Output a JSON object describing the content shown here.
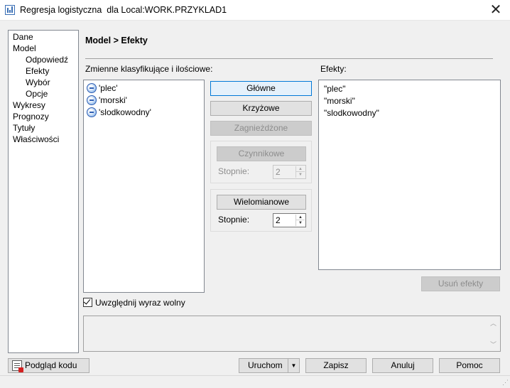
{
  "window": {
    "title": "Regresja logistyczna  dla Local:WORK.PRZYKLAD1",
    "app_icon": "chart-bars-icon",
    "close_icon": "close-icon",
    "close_glyph": "✕"
  },
  "nav": {
    "items": [
      {
        "label": "Dane"
      },
      {
        "label": "Model"
      },
      {
        "label": "Odpowiedź"
      },
      {
        "label": "Efekty"
      },
      {
        "label": "Wybór"
      },
      {
        "label": "Opcje"
      },
      {
        "label": "Wykresy"
      },
      {
        "label": "Prognozy"
      },
      {
        "label": "Tytuły"
      },
      {
        "label": "Właściwości"
      }
    ],
    "selected": "Efekty"
  },
  "content": {
    "title": "Model > Efekty",
    "variables_label": "Zmienne klasyfikujące i ilościowe:",
    "variables": [
      "'plec'",
      "'morski'",
      "'slodkowodny'"
    ],
    "variable_icon": "variable-globe-icon",
    "effects_label": "Efekty:",
    "effects": [
      "\"plec\"",
      "\"morski\"",
      "\"slodkowodny\""
    ]
  },
  "buttons": {
    "main": "Główne",
    "cross": "Krzyżowe",
    "nested": "Zagnieżdżone",
    "factorial": "Czynnikowe",
    "polynomial": "Wielomianowe",
    "remove_effects": "Usuń efekty"
  },
  "factorial": {
    "degrees_label": "Stopnie:",
    "degrees_value": "2",
    "enabled": false
  },
  "polynomial": {
    "degree_label": "Stopnie:",
    "degree_value": "2"
  },
  "spin": {
    "up": "▲",
    "down": "▼"
  },
  "intercept": {
    "label": "Uwzględnij wyraz wolny",
    "checked": true
  },
  "textarea_scroll": {
    "up": "︿",
    "down": "﹀"
  },
  "footer": {
    "preview_code": "Podgląd kodu",
    "run": "Uruchom",
    "run_dropdown": "▼",
    "save": "Zapisz",
    "cancel": "Anuluj",
    "help": "Pomoc",
    "resize_grip": "⋰"
  },
  "colors": {
    "primary_border": "#0078d7",
    "disabled_bg": "#cccccc",
    "disabled_text": "#8d8d8d"
  }
}
